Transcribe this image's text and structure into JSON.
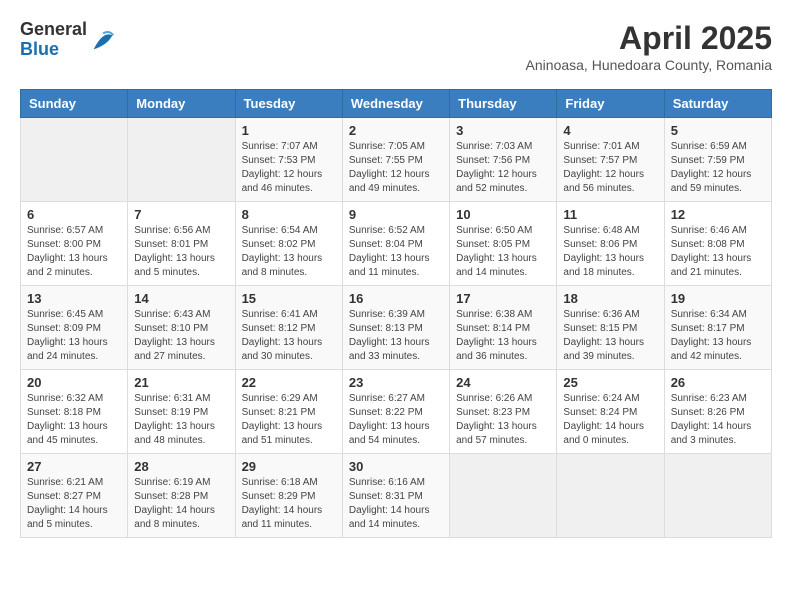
{
  "logo": {
    "general": "General",
    "blue": "Blue"
  },
  "title": "April 2025",
  "subtitle": "Aninoasa, Hunedoara County, Romania",
  "weekdays": [
    "Sunday",
    "Monday",
    "Tuesday",
    "Wednesday",
    "Thursday",
    "Friday",
    "Saturday"
  ],
  "weeks": [
    [
      {
        "day": "",
        "info": ""
      },
      {
        "day": "",
        "info": ""
      },
      {
        "day": "1",
        "info": "Sunrise: 7:07 AM\nSunset: 7:53 PM\nDaylight: 12 hours and 46 minutes."
      },
      {
        "day": "2",
        "info": "Sunrise: 7:05 AM\nSunset: 7:55 PM\nDaylight: 12 hours and 49 minutes."
      },
      {
        "day": "3",
        "info": "Sunrise: 7:03 AM\nSunset: 7:56 PM\nDaylight: 12 hours and 52 minutes."
      },
      {
        "day": "4",
        "info": "Sunrise: 7:01 AM\nSunset: 7:57 PM\nDaylight: 12 hours and 56 minutes."
      },
      {
        "day": "5",
        "info": "Sunrise: 6:59 AM\nSunset: 7:59 PM\nDaylight: 12 hours and 59 minutes."
      }
    ],
    [
      {
        "day": "6",
        "info": "Sunrise: 6:57 AM\nSunset: 8:00 PM\nDaylight: 13 hours and 2 minutes."
      },
      {
        "day": "7",
        "info": "Sunrise: 6:56 AM\nSunset: 8:01 PM\nDaylight: 13 hours and 5 minutes."
      },
      {
        "day": "8",
        "info": "Sunrise: 6:54 AM\nSunset: 8:02 PM\nDaylight: 13 hours and 8 minutes."
      },
      {
        "day": "9",
        "info": "Sunrise: 6:52 AM\nSunset: 8:04 PM\nDaylight: 13 hours and 11 minutes."
      },
      {
        "day": "10",
        "info": "Sunrise: 6:50 AM\nSunset: 8:05 PM\nDaylight: 13 hours and 14 minutes."
      },
      {
        "day": "11",
        "info": "Sunrise: 6:48 AM\nSunset: 8:06 PM\nDaylight: 13 hours and 18 minutes."
      },
      {
        "day": "12",
        "info": "Sunrise: 6:46 AM\nSunset: 8:08 PM\nDaylight: 13 hours and 21 minutes."
      }
    ],
    [
      {
        "day": "13",
        "info": "Sunrise: 6:45 AM\nSunset: 8:09 PM\nDaylight: 13 hours and 24 minutes."
      },
      {
        "day": "14",
        "info": "Sunrise: 6:43 AM\nSunset: 8:10 PM\nDaylight: 13 hours and 27 minutes."
      },
      {
        "day": "15",
        "info": "Sunrise: 6:41 AM\nSunset: 8:12 PM\nDaylight: 13 hours and 30 minutes."
      },
      {
        "day": "16",
        "info": "Sunrise: 6:39 AM\nSunset: 8:13 PM\nDaylight: 13 hours and 33 minutes."
      },
      {
        "day": "17",
        "info": "Sunrise: 6:38 AM\nSunset: 8:14 PM\nDaylight: 13 hours and 36 minutes."
      },
      {
        "day": "18",
        "info": "Sunrise: 6:36 AM\nSunset: 8:15 PM\nDaylight: 13 hours and 39 minutes."
      },
      {
        "day": "19",
        "info": "Sunrise: 6:34 AM\nSunset: 8:17 PM\nDaylight: 13 hours and 42 minutes."
      }
    ],
    [
      {
        "day": "20",
        "info": "Sunrise: 6:32 AM\nSunset: 8:18 PM\nDaylight: 13 hours and 45 minutes."
      },
      {
        "day": "21",
        "info": "Sunrise: 6:31 AM\nSunset: 8:19 PM\nDaylight: 13 hours and 48 minutes."
      },
      {
        "day": "22",
        "info": "Sunrise: 6:29 AM\nSunset: 8:21 PM\nDaylight: 13 hours and 51 minutes."
      },
      {
        "day": "23",
        "info": "Sunrise: 6:27 AM\nSunset: 8:22 PM\nDaylight: 13 hours and 54 minutes."
      },
      {
        "day": "24",
        "info": "Sunrise: 6:26 AM\nSunset: 8:23 PM\nDaylight: 13 hours and 57 minutes."
      },
      {
        "day": "25",
        "info": "Sunrise: 6:24 AM\nSunset: 8:24 PM\nDaylight: 14 hours and 0 minutes."
      },
      {
        "day": "26",
        "info": "Sunrise: 6:23 AM\nSunset: 8:26 PM\nDaylight: 14 hours and 3 minutes."
      }
    ],
    [
      {
        "day": "27",
        "info": "Sunrise: 6:21 AM\nSunset: 8:27 PM\nDaylight: 14 hours and 5 minutes."
      },
      {
        "day": "28",
        "info": "Sunrise: 6:19 AM\nSunset: 8:28 PM\nDaylight: 14 hours and 8 minutes."
      },
      {
        "day": "29",
        "info": "Sunrise: 6:18 AM\nSunset: 8:29 PM\nDaylight: 14 hours and 11 minutes."
      },
      {
        "day": "30",
        "info": "Sunrise: 6:16 AM\nSunset: 8:31 PM\nDaylight: 14 hours and 14 minutes."
      },
      {
        "day": "",
        "info": ""
      },
      {
        "day": "",
        "info": ""
      },
      {
        "day": "",
        "info": ""
      }
    ]
  ]
}
